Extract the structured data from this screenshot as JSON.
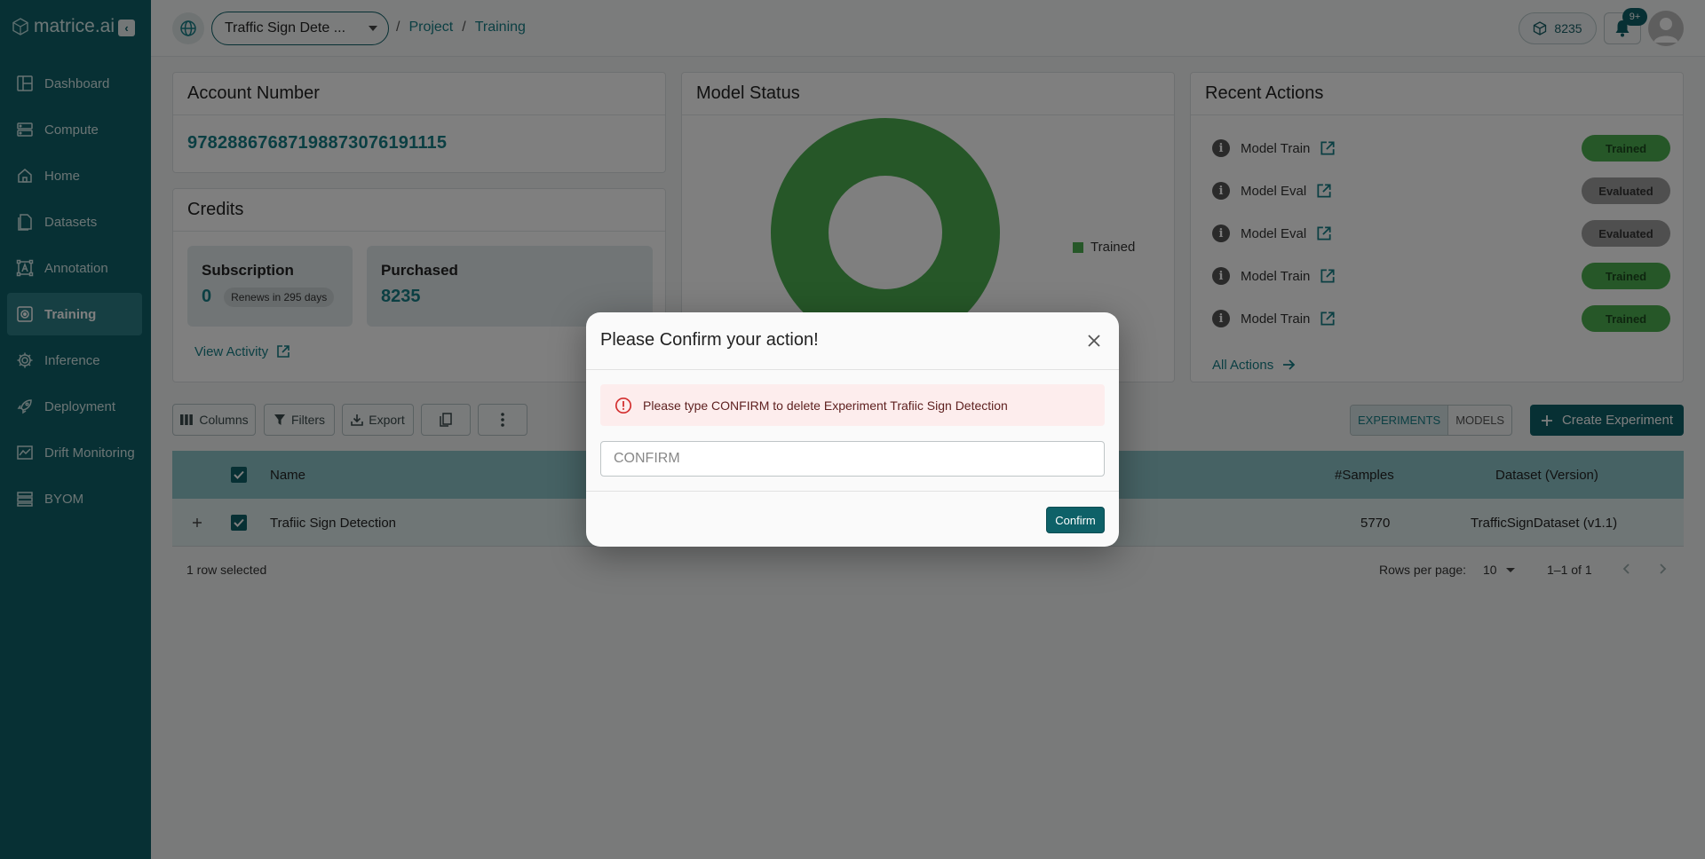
{
  "brand": {
    "name": "matrice.ai"
  },
  "sidebar": {
    "items": [
      {
        "label": "Dashboard",
        "icon": "dashboard-icon"
      },
      {
        "label": "Compute",
        "icon": "server-icon"
      },
      {
        "label": "Home",
        "icon": "home-icon"
      },
      {
        "label": "Datasets",
        "icon": "file-icon"
      },
      {
        "label": "Annotation",
        "icon": "annotation-icon"
      },
      {
        "label": "Training",
        "icon": "training-icon",
        "active": true
      },
      {
        "label": "Inference",
        "icon": "gear-icon"
      },
      {
        "label": "Deployment",
        "icon": "rocket-icon"
      },
      {
        "label": "Drift Monitoring",
        "icon": "chart-icon"
      },
      {
        "label": "BYOM",
        "icon": "layers-icon"
      }
    ]
  },
  "header": {
    "project_select": "Traffic Sign Dete ...",
    "breadcrumb": [
      "Project",
      "Training"
    ],
    "credits": "8235",
    "notifications_badge": "9+"
  },
  "account": {
    "title": "Account Number",
    "number": "97828867687198873076191115"
  },
  "credits_card": {
    "title": "Credits",
    "subscription_label": "Subscription",
    "subscription_value": "0",
    "renew_text": "Renews in 295 days",
    "purchased_label": "Purchased",
    "purchased_value": "8235",
    "view_activity": "View Activity"
  },
  "model_status": {
    "title": "Model Status",
    "legend": "Trained",
    "chart_data": {
      "type": "pie",
      "categories": [
        "Trained"
      ],
      "values": [
        100
      ],
      "title": "Model Status"
    }
  },
  "recent_actions": {
    "title": "Recent Actions",
    "items": [
      {
        "name": "Model Train",
        "status": "Trained"
      },
      {
        "name": "Model Eval",
        "status": "Evaluated"
      },
      {
        "name": "Model Eval",
        "status": "Evaluated"
      },
      {
        "name": "Model Train",
        "status": "Trained"
      },
      {
        "name": "Model Train",
        "status": "Trained"
      }
    ],
    "all_actions": "All Actions"
  },
  "toolbar": {
    "columns": "Columns",
    "filters": "Filters",
    "export": "Export",
    "experiments_tab": "EXPERIMENTS",
    "models_tab": "MODELS",
    "create_experiment": "Create Experiment"
  },
  "table": {
    "headers": {
      "name": "Name",
      "samples": "#Samples",
      "dataset": "Dataset (Version)"
    },
    "rows": [
      {
        "name": "Trafiic Sign Detection",
        "samples": "5770",
        "dataset": "TrafficSignDataset (v1.1)"
      }
    ],
    "selected_text": "1 row selected",
    "rows_per_page_label": "Rows per page:",
    "rows_per_page_value": "10",
    "range": "1–1 of 1"
  },
  "modal": {
    "title": "Please Confirm your action!",
    "alert": "Please type CONFIRM to delete Experiment Trafiic Sign Detection",
    "input_placeholder": "CONFIRM",
    "input_value": "",
    "confirm_label": "Confirm"
  },
  "colors": {
    "sidebar": "#0e6168",
    "accent": "#167e86",
    "trained": "#4caf50",
    "evaluated": "#9e9e9e",
    "alert_bg": "#fdeded",
    "alert_icon": "#d32f2f"
  }
}
